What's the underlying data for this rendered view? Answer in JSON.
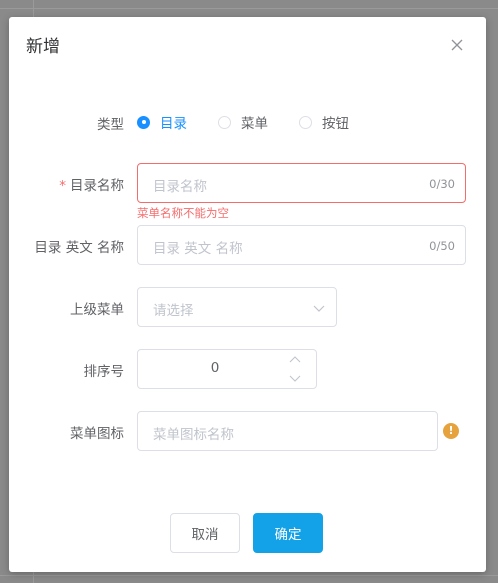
{
  "dialog": {
    "title": "新增"
  },
  "form": {
    "type": {
      "label": "类型",
      "options": [
        "目录",
        "菜单",
        "按钮"
      ],
      "selected": "目录"
    },
    "dir_name": {
      "label": "目录名称",
      "required_mark": "*",
      "placeholder": "目录名称",
      "counter": "0/30",
      "error": "菜单名称不能为空"
    },
    "dir_name_en": {
      "label": "目录 英文 名称",
      "placeholder": "目录 英文 名称",
      "counter": "0/50"
    },
    "parent_menu": {
      "label": "上级菜单",
      "placeholder": "请选择"
    },
    "sort_no": {
      "label": "排序号",
      "value": "0"
    },
    "menu_icon": {
      "label": "菜单图标",
      "placeholder": "菜单图标名称",
      "hint_icon": "warning-icon"
    }
  },
  "footer": {
    "cancel_label": "取消",
    "ok_label": "确定"
  },
  "colors": {
    "primary": "#13a2e8",
    "radio_active": "#1890ff",
    "error": "#f56c6c",
    "warning": "#e6a23c"
  }
}
